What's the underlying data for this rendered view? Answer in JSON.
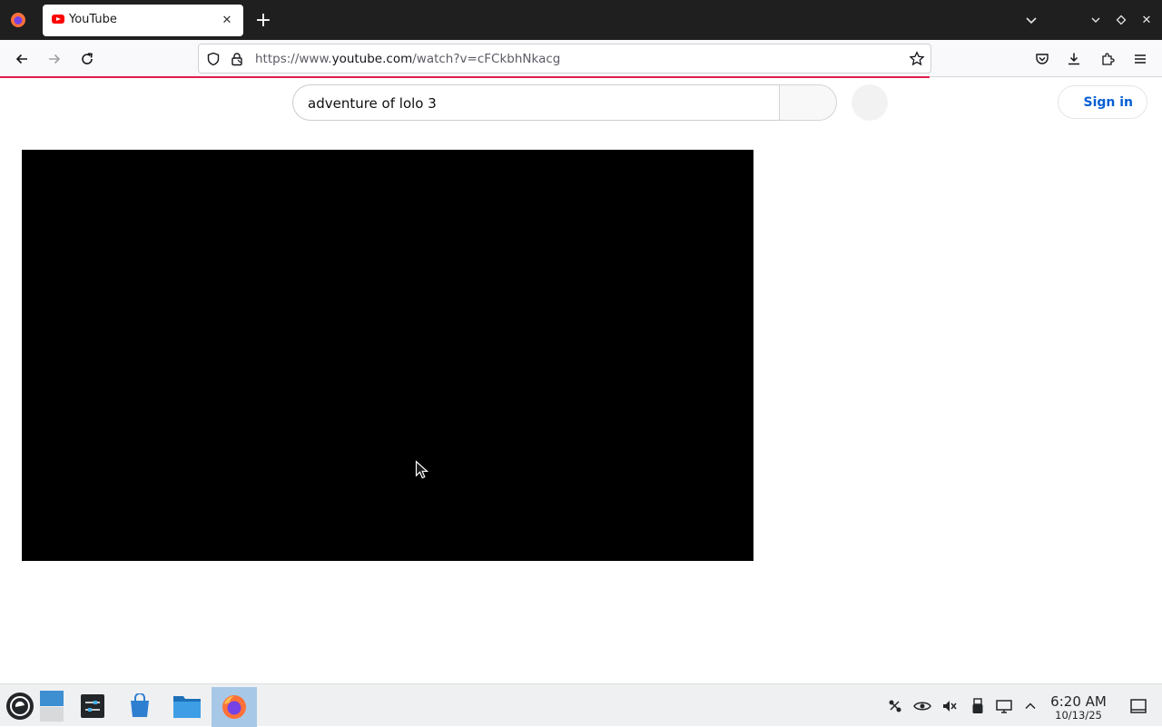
{
  "browser": {
    "tab_title": "YouTube",
    "url_prefix": "https://www.",
    "url_host": "youtube.com",
    "url_path": "/watch?v=cFCkbhNkacg",
    "accent_color": "#e31b4d"
  },
  "page": {
    "search_value": "adventure of lolo 3",
    "sign_in_label": "Sign in"
  },
  "taskbar": {
    "time": "6:20 AM",
    "date": "10/13/25"
  },
  "icons": [
    "firefox-icon",
    "youtube-favicon",
    "close-icon",
    "plus-icon",
    "chevron-down-icon",
    "minimize-icon",
    "maximize-icon",
    "back-arrow-icon",
    "forward-arrow-icon",
    "reload-icon",
    "shield-icon",
    "lock-icon",
    "star-icon",
    "pocket-icon",
    "download-icon",
    "extensions-icon",
    "hamburger-menu-icon"
  ]
}
